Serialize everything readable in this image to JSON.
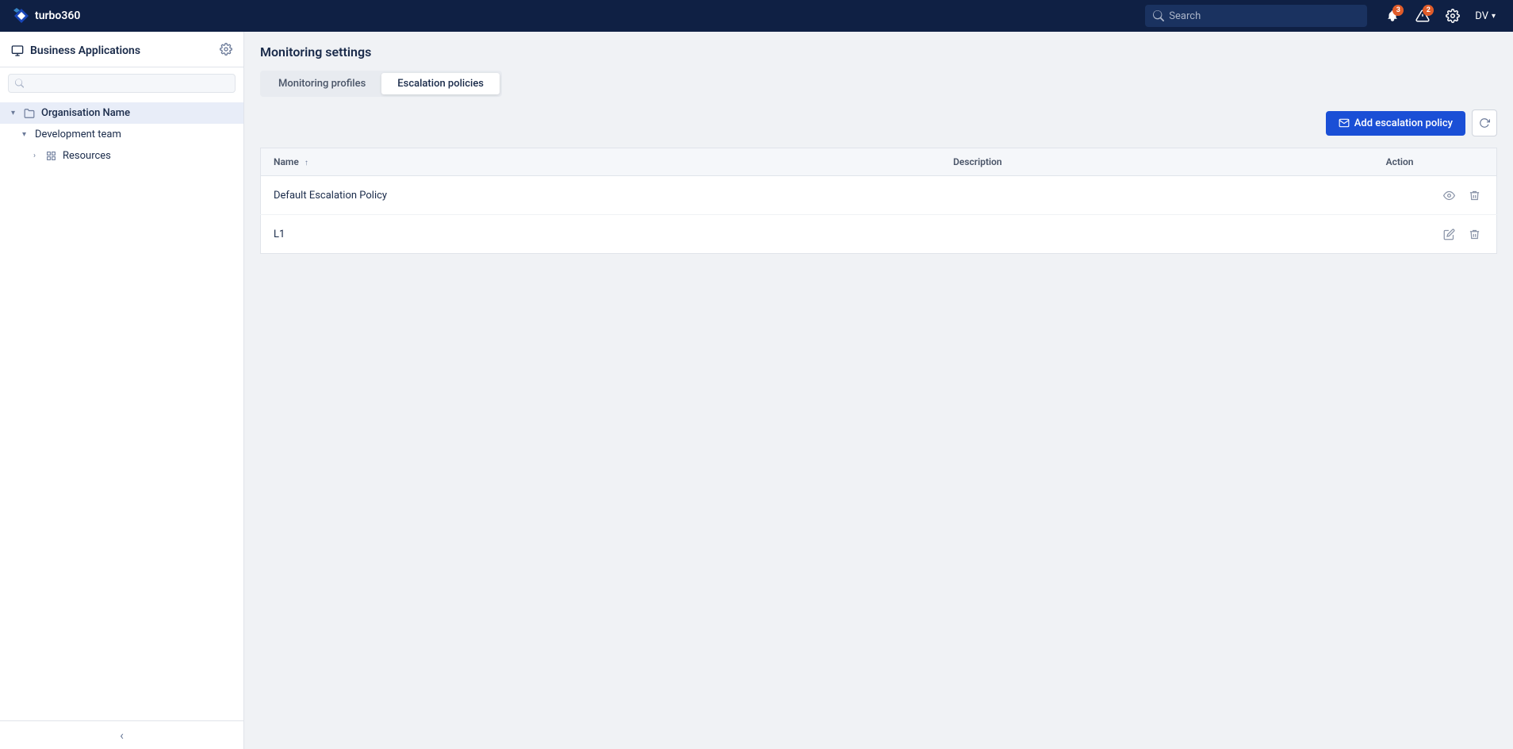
{
  "app": {
    "name": "turbo360",
    "logo_alt": "turbo360 logo"
  },
  "topnav": {
    "search_placeholder": "Search",
    "notifications_badge": "3",
    "alerts_badge": "2",
    "user_initials": "DV"
  },
  "sidebar": {
    "title": "Business Applications",
    "search_placeholder": "",
    "tree": [
      {
        "label": "Organisation Name",
        "level": 0,
        "chevron": "▾",
        "icon": "🗂",
        "selected": true
      },
      {
        "label": "Development team",
        "level": 1,
        "chevron": "▾",
        "icon": ""
      },
      {
        "label": "Resources",
        "level": 2,
        "chevron": "›",
        "icon": "⊞"
      }
    ],
    "collapse_label": "‹"
  },
  "content": {
    "page_title": "Monitoring settings",
    "tabs": [
      {
        "id": "monitoring-profiles",
        "label": "Monitoring profiles",
        "active": false
      },
      {
        "id": "escalation-policies",
        "label": "Escalation policies",
        "active": true
      }
    ],
    "toolbar": {
      "add_button_label": "Add escalation policy",
      "refresh_label": "Refresh"
    },
    "table": {
      "columns": [
        {
          "id": "name",
          "label": "Name",
          "sortable": true,
          "sort_direction": "asc"
        },
        {
          "id": "description",
          "label": "Description",
          "sortable": false
        },
        {
          "id": "action",
          "label": "Action",
          "sortable": false
        }
      ],
      "rows": [
        {
          "id": 1,
          "name": "Default Escalation Policy",
          "description": "",
          "can_view": true,
          "can_edit": false,
          "can_delete": true
        },
        {
          "id": 2,
          "name": "L1",
          "description": "",
          "can_view": false,
          "can_edit": true,
          "can_delete": true
        }
      ]
    }
  }
}
